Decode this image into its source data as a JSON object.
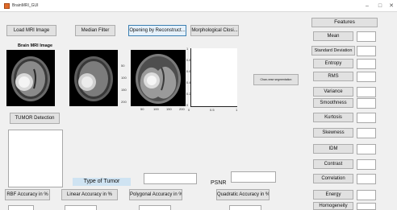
{
  "window": {
    "title": "BrainMRI_GUI",
    "minimize": "–",
    "maximize": "□",
    "close": "✕"
  },
  "toolbar": {
    "load": "Load MRI Image",
    "median": "Median Filter",
    "opening": "Opening by Reconstruct...",
    "morph": "Morphological Closi...",
    "tumor": "TUMOR Detection",
    "chan_vese": "Chan-vese segmentation"
  },
  "images": {
    "title": "Brain MRI Image"
  },
  "axes": {
    "ticks_y1": [
      "50",
      "100",
      "150",
      "200"
    ],
    "ticks_x1": [
      "50",
      "100",
      "150",
      "200"
    ],
    "ticks_y2": [
      "1",
      "0.8",
      "0.6",
      "0.4",
      "0.2",
      "0"
    ],
    "ticks_x2": [
      "0",
      "0.5",
      "1"
    ]
  },
  "features": {
    "header": "Features",
    "items": [
      "Mean",
      "Standard Deviation",
      "Entropy",
      "RMS",
      "Variance",
      "Smoothness",
      "Kurtosis",
      "Skewness",
      "IDM",
      "Contrast",
      "Correlation",
      "Energy",
      "Homogeneity"
    ]
  },
  "bottom": {
    "type_label": "Type of Tumor",
    "psnr_label": "PSNR",
    "rbf": "RBF Accuracy in %",
    "linear": "Linear Accuracy in %",
    "polygonal": "Polygonal Accuracy in %",
    "quadratic": "Quadratic Accuracy in %"
  },
  "colors": {
    "background": "#f0f0f0",
    "button": "#e1e1e1",
    "active_border": "#3c7fb1",
    "type_label_bg": "#cfe3f2"
  }
}
